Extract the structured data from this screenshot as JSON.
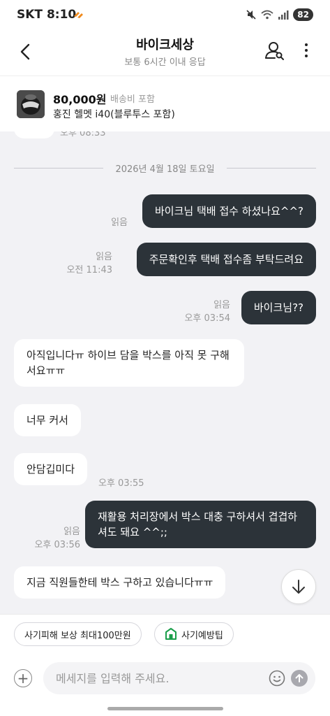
{
  "status": {
    "carrier": "SKT",
    "time": "8:10",
    "battery": "82"
  },
  "header": {
    "title": "바이크세상",
    "subtitle": "보통 6시간 이내 응답"
  },
  "product": {
    "price": "80,000원",
    "shipping": "배송비 포함",
    "name": "홍진 헬멧 i40(블루투스 포함)"
  },
  "chat": {
    "prev_time": "오후 08:33",
    "date": "2026년 4월 18일 토요일",
    "messages": [
      {
        "dir": "out",
        "text": "바이크님  택배  접수 하셨나요^^?",
        "read": "읽음",
        "time": ""
      },
      {
        "dir": "out",
        "text": "주문확인후  택배 접수좀  부탁드려요",
        "read": "읽음",
        "time": "오전 11:43"
      },
      {
        "dir": "out",
        "text": "바이크님??",
        "read": "읽음",
        "time": "오후 03:54"
      },
      {
        "dir": "in",
        "text": "아직입니다ㅠ 하이브 담을 박스를 아직 못 구해서요ㅠㅠ",
        "time": ""
      },
      {
        "dir": "in",
        "text": "너무 커서",
        "time": ""
      },
      {
        "dir": "in",
        "text": "안담깁미다",
        "time": "오후 03:55"
      },
      {
        "dir": "out",
        "text": "재활용 처리장에서 박스 대충 구하셔서 겹겹하셔도  돼요 ^^;;",
        "read": "읽음",
        "time": "오후 03:56"
      },
      {
        "dir": "in",
        "text": "지금 직원들한테 박스 구하고 있습니다ㅠㅠ",
        "time": ""
      }
    ]
  },
  "chips": {
    "safety_reward": "사기피해 보상 최대100만원",
    "safety_tips": "사기예방팁"
  },
  "input": {
    "placeholder": "메세지를 입력해 주세요.",
    "value": ""
  },
  "icons": {
    "back": "chevron-left-icon",
    "profile": "user-search-icon",
    "more": "more-vertical-icon",
    "scroll": "arrow-down-icon",
    "add": "plus-circle-icon",
    "emoji": "smile-icon",
    "send": "arrow-up-icon"
  },
  "colors": {
    "outgoing_bubble": "#2c3339",
    "incoming_bubble": "#ffffff",
    "background": "#f2f2f5",
    "safety_green": "#1a9e4a"
  }
}
